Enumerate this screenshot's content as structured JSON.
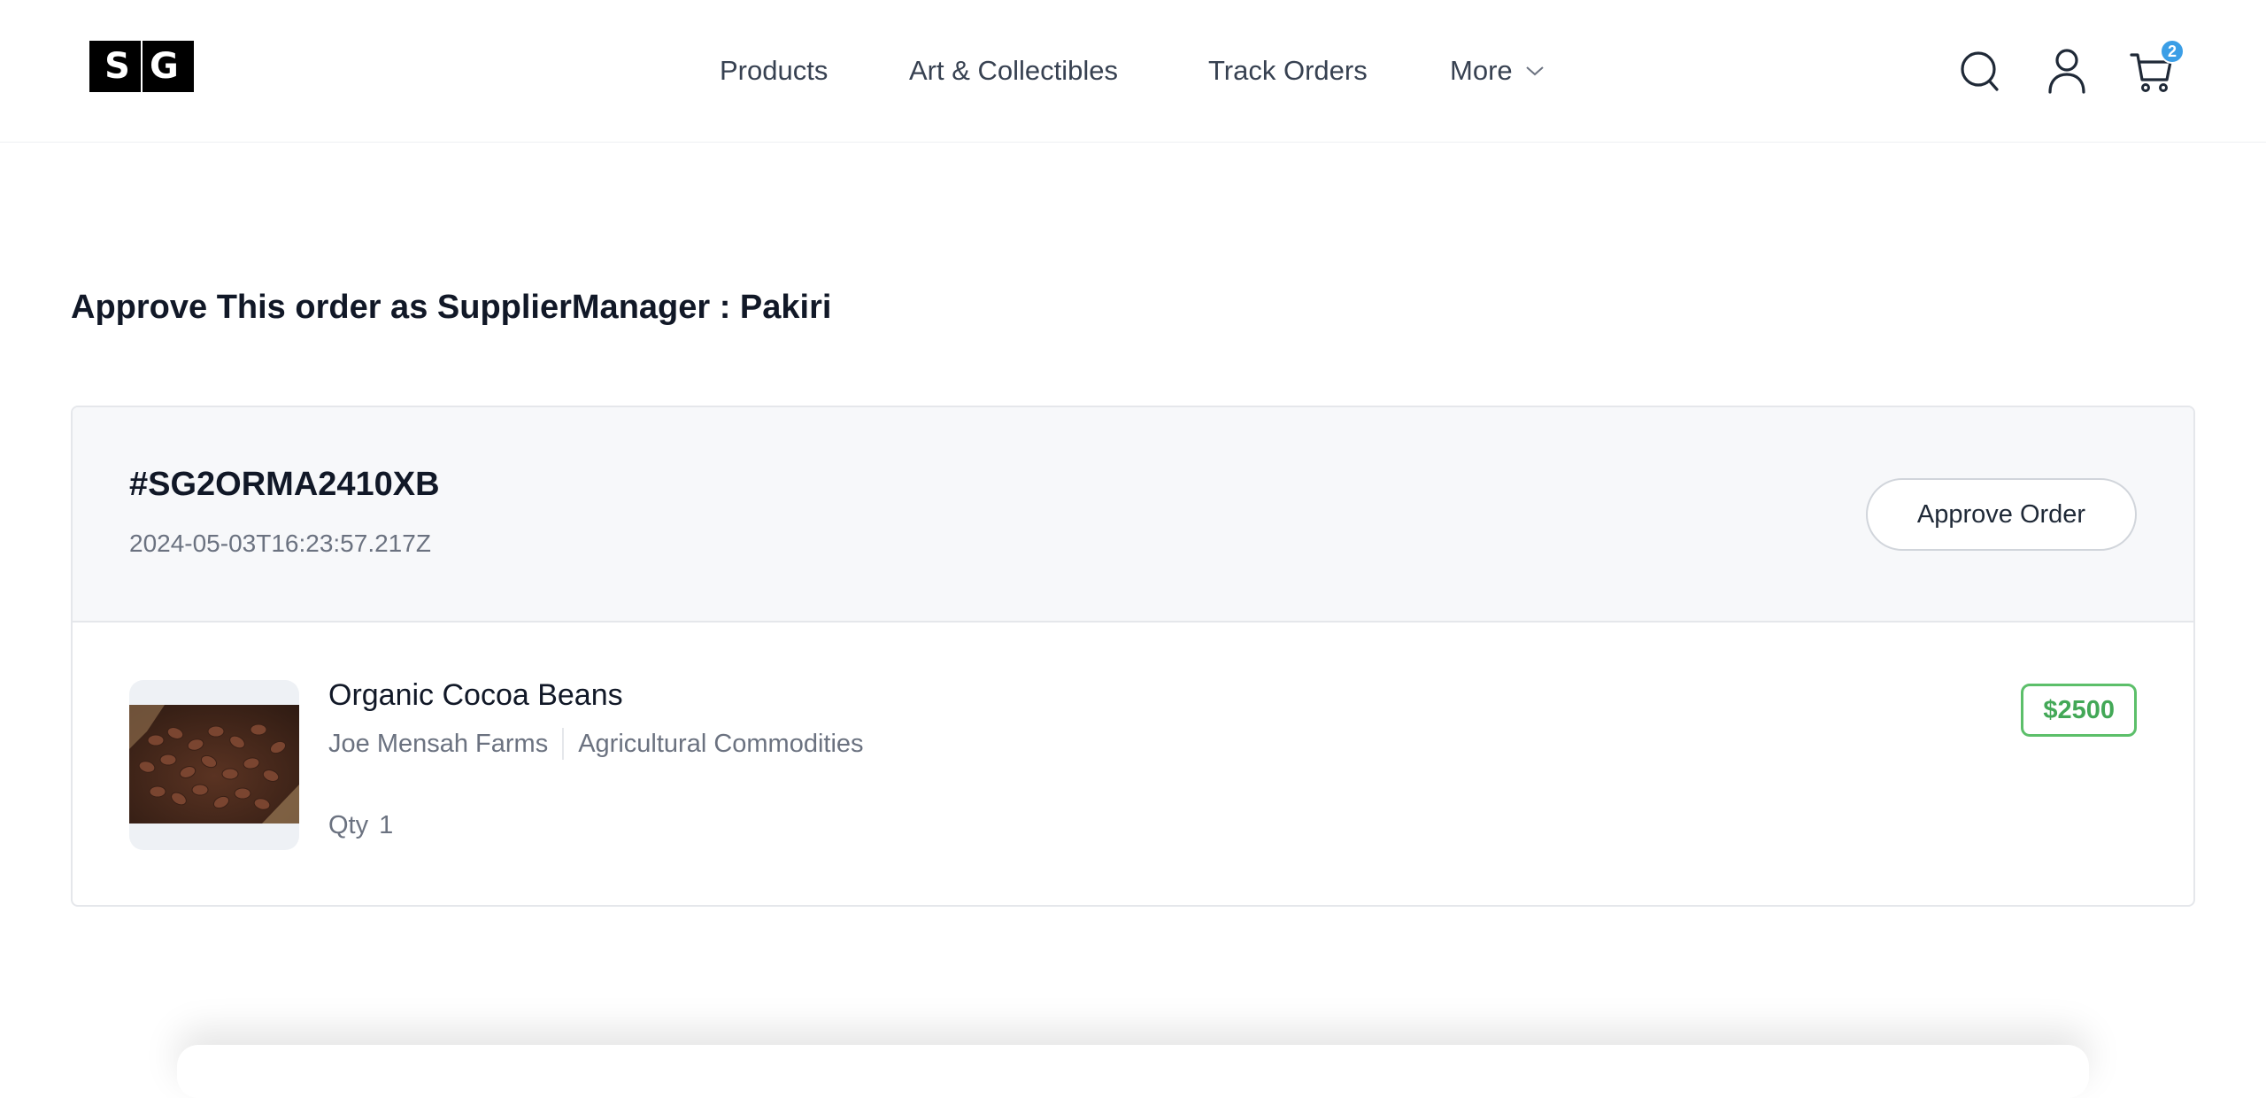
{
  "header": {
    "logo": {
      "left_letter": "S",
      "right_letter": "G"
    },
    "nav": [
      {
        "label": "Products"
      },
      {
        "label": "Art & Collectibles"
      },
      {
        "label": "Track Orders"
      },
      {
        "label": "More"
      }
    ],
    "icons": [
      "search-icon",
      "user-icon",
      "cart-icon",
      "chevron-down-icon"
    ],
    "cart_count": "2",
    "accent_color": "#3b9ee6"
  },
  "page": {
    "title": "Approve This order as SupplierManager : Pakiri"
  },
  "order": {
    "id": "#SG2ORMA2410XB",
    "date": "2024-05-03T16:23:57.217Z",
    "approve_label": "Approve Order",
    "item": {
      "name": "Organic Cocoa Beans",
      "supplier": "Joe Mensah Farms",
      "category": "Agricultural Commodities",
      "qty_label": "Qty",
      "qty": "1",
      "price": "$2500",
      "price_color": "#43a857"
    }
  }
}
